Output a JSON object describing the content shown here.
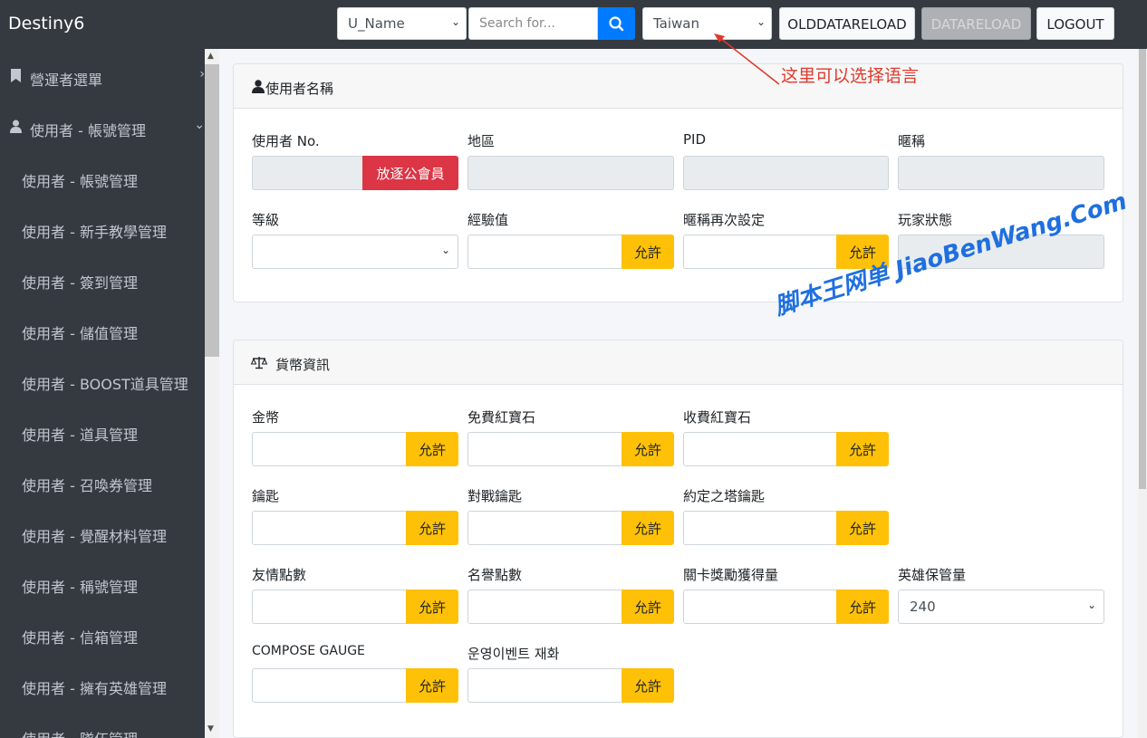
{
  "app": {
    "brand": "Destiny6"
  },
  "navbar": {
    "field_select": "U_Name",
    "search_placeholder": "Search for...",
    "language_select": "Taiwan",
    "old_reload_label": "OLDDATARELOAD",
    "reload_label": "DATARELOAD",
    "logout_label": "LOGOUT",
    "annotation": "这里可以选择语言"
  },
  "sidebar": {
    "items": [
      {
        "label": "營運者選單"
      },
      {
        "label": "使用者 - 帳號管理"
      },
      {
        "label": "使用者 - 帳號管理"
      },
      {
        "label": "使用者 - 新手教學管理"
      },
      {
        "label": "使用者 - 簽到管理"
      },
      {
        "label": "使用者 - 儲值管理"
      },
      {
        "label": "使用者 - BOOST道具管理"
      },
      {
        "label": "使用者 - 道具管理"
      },
      {
        "label": "使用者 - 召喚券管理"
      },
      {
        "label": "使用者 - 覺醒材料管理"
      },
      {
        "label": "使用者 - 稱號管理"
      },
      {
        "label": "使用者 - 信箱管理"
      },
      {
        "label": "使用者 - 擁有英雄管理"
      },
      {
        "label": "使用者 - 隊伍管理"
      }
    ]
  },
  "user_card": {
    "title": "使用者名稱",
    "fields": {
      "user_no": "使用者 No.",
      "region": "地區",
      "pid": "PID",
      "nickname": "暱稱",
      "level": "等級",
      "exp": "經驗值",
      "nickname_reset": "暱稱再次設定",
      "player_status": "玩家狀態"
    },
    "kick_guild_label": "放逐公會員",
    "allow_label": "允許"
  },
  "currency_card": {
    "title": "貨幣資訊",
    "fields": {
      "gold": "金幣",
      "free_ruby": "免費紅寶石",
      "paid_ruby": "收費紅寶石",
      "key": "鑰匙",
      "pvp_key": "對戰鑰匙",
      "tower_key": "約定之塔鑰匙",
      "friend_points": "友情點數",
      "fame_points": "名譽點數",
      "stage_reward": "關卡獎勵獲得量",
      "hero_storage": "英雄保管量",
      "compose_gauge": "COMPOSE GAUGE",
      "event_currency": "운영이벤트 재화"
    },
    "hero_storage_value": "240",
    "allow_label": "允許"
  },
  "watermark": "脚本王网单 JiaoBenWang.Com"
}
